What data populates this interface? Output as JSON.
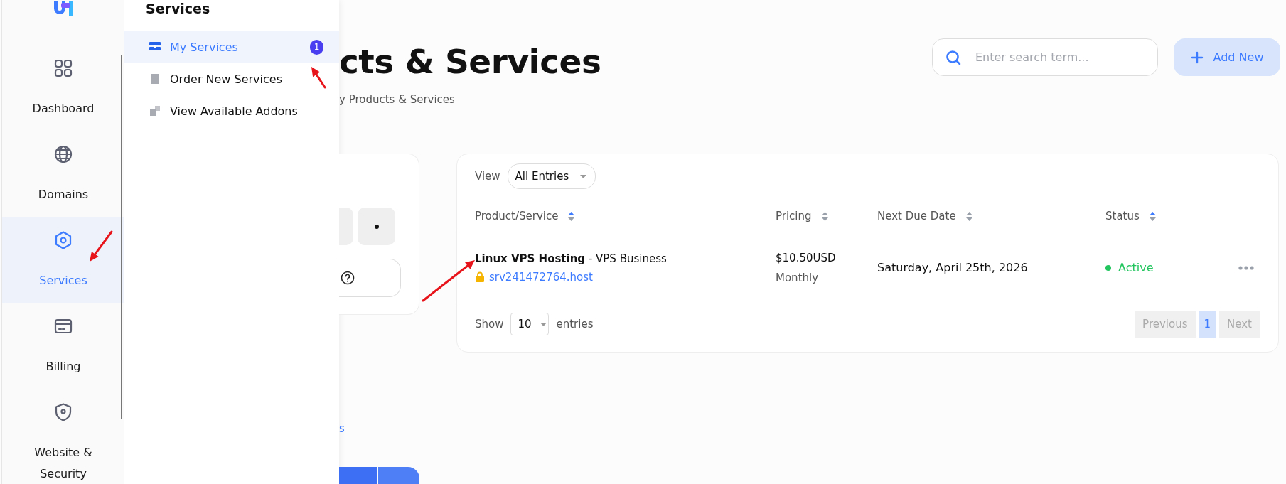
{
  "sidebar": {
    "items": [
      {
        "label": "Dashboard",
        "selected": false
      },
      {
        "label": "Domains",
        "selected": false
      },
      {
        "label": "Services",
        "selected": true
      },
      {
        "label": "Billing",
        "selected": false
      },
      {
        "label": "Website & Security",
        "selected": false
      }
    ]
  },
  "flyout": {
    "title": "Services",
    "items": [
      {
        "label": "My Services",
        "selected": true,
        "badge": "1"
      },
      {
        "label": "Order New Services",
        "selected": false
      },
      {
        "label": "View Available Addons",
        "selected": false
      }
    ]
  },
  "page": {
    "title": "cts & Services",
    "breadcrumb": "y Products & Services"
  },
  "search": {
    "placeholder": "Enter search term..."
  },
  "add_button": {
    "label": "Add New"
  },
  "side_panel": {
    "link": "s"
  },
  "table": {
    "view_label": "View",
    "view_value": "All Entries",
    "columns": [
      {
        "label": "Product/Service",
        "sorted": true
      },
      {
        "label": "Pricing",
        "sorted": false
      },
      {
        "label": "Next Due Date",
        "sorted": false
      },
      {
        "label": "Status",
        "sorted": true
      }
    ],
    "rows": [
      {
        "product": "**Linux VPS Hosting** - VPS Business",
        "domain": "srv241472764.host",
        "price": "$10.50USD",
        "cycle": "Monthly",
        "due": "Saturday, April 25th, 2026",
        "status": "Active",
        "color": "#22c55e"
      }
    ],
    "show_label": "Show",
    "page_size": "10",
    "entries_label": "entries",
    "pagination": [
      {
        "label": "Previous",
        "selected": false,
        "disabled": true
      },
      {
        "label": "1",
        "selected": true,
        "disabled": false
      },
      {
        "label": "Next",
        "selected": false,
        "disabled": true
      }
    ]
  }
}
